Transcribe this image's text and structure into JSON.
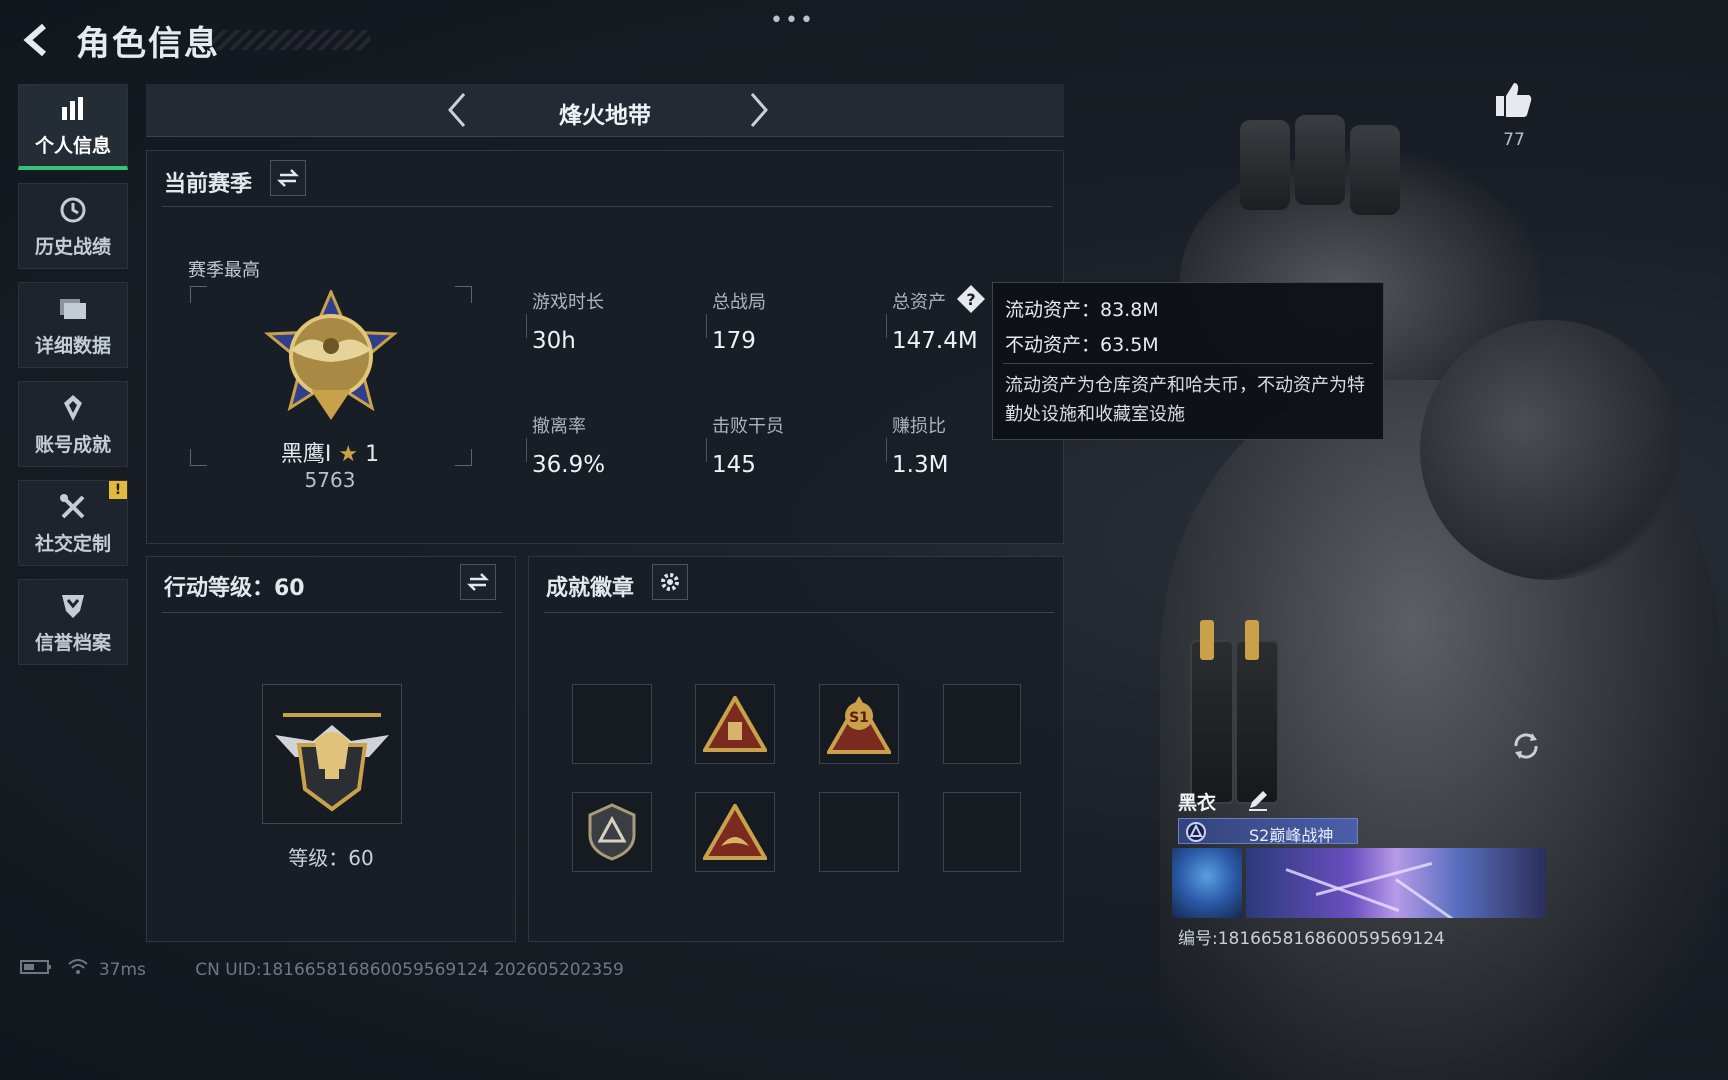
{
  "header": {
    "title": "角色信息",
    "more_label": "•••"
  },
  "sidebar": {
    "items": [
      {
        "label": "个人信息",
        "icon": "bar-chart-icon",
        "active": true
      },
      {
        "label": "历史战绩",
        "icon": "history-clock-icon"
      },
      {
        "label": "详细数据",
        "icon": "folder-icon"
      },
      {
        "label": "账号成就",
        "icon": "achievement-icon"
      },
      {
        "label": "社交定制",
        "icon": "tools-icon",
        "badge": "!"
      },
      {
        "label": "信誉档案",
        "icon": "shield-chevron-icon"
      }
    ]
  },
  "mode": {
    "title": "烽火地带"
  },
  "season": {
    "title": "当前赛季",
    "best_label": "赛季最高",
    "rank_name": "黑鹰Ⅰ",
    "rank_stars": "1",
    "rank_score": "5763",
    "stats": [
      {
        "label": "游戏时长",
        "value": "30h"
      },
      {
        "label": "总战局",
        "value": "179"
      },
      {
        "label": "总资产",
        "value": "147.4M"
      },
      {
        "label": "撤离率",
        "value": "36.9%"
      },
      {
        "label": "击败干员",
        "value": "145"
      },
      {
        "label": "赚损比",
        "value": "1.3M"
      }
    ]
  },
  "tooltip": {
    "liquid": "流动资产：83.8M",
    "fixed": "不动资产：63.5M",
    "desc": "流动资产为仓库资产和哈夫币，不动资产为特勤处设施和收藏室设施"
  },
  "level": {
    "title": "行动等级：60",
    "text": "等级：60"
  },
  "badges": {
    "title": "成就徽章",
    "s1_label": "S1"
  },
  "player": {
    "like_count": "77",
    "name": "黑衣",
    "title_badge": "S2巅峰战神",
    "uid": "编号:181665816860059569124"
  },
  "status": {
    "ping": "37ms",
    "uid_line": "CN UID:181665816860059569124 202605202359"
  },
  "colors": {
    "accent_green": "#37c27a",
    "warn_yellow": "#e2b93b",
    "gold": "#c9a14a"
  }
}
